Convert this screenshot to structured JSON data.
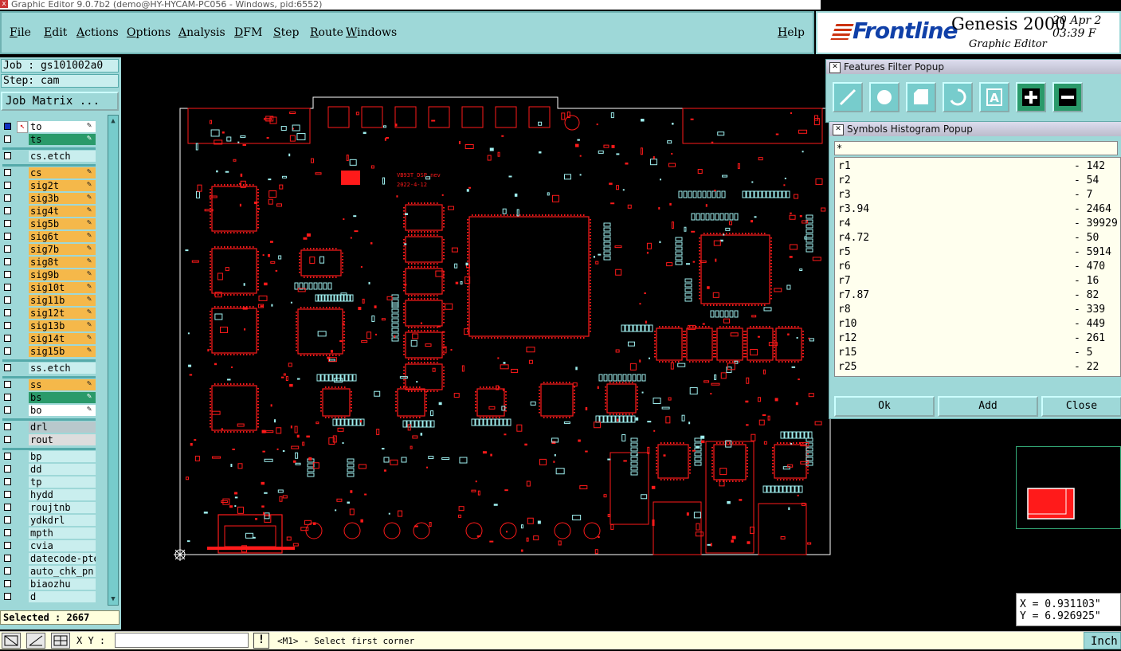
{
  "window": {
    "title": "Graphic Editor 9.0.7b2 (demo@HY-HYCAM-PC056 - Windows, pid:6552)"
  },
  "menu": {
    "items": [
      "File",
      "Edit",
      "Actions",
      "Options",
      "Analysis",
      "DFM",
      "Step",
      "Route",
      "Windows"
    ],
    "help": "Help"
  },
  "brand": {
    "logo": "Frontline",
    "product": "Genesis 2000",
    "subtitle": "Graphic Editor",
    "date": "20 Apr 2",
    "time": "03:39 F"
  },
  "job": {
    "job_label": "Job : gs101002a0",
    "step_label": "Step: cam",
    "matrix_button": "Job Matrix ..."
  },
  "layers": [
    {
      "name": "to",
      "color": "#ffffff",
      "group": 1
    },
    {
      "name": "ts",
      "color": "#2a9a6a",
      "group": 1
    },
    {
      "name": "cs.etch",
      "color": "#c9eeee",
      "group": 2
    },
    {
      "name": "cs",
      "color": "#f5b84a",
      "group": 3
    },
    {
      "name": "sig2t",
      "color": "#f5b84a",
      "group": 3
    },
    {
      "name": "sig3b",
      "color": "#f5b84a",
      "group": 3
    },
    {
      "name": "sig4t",
      "color": "#f5b84a",
      "group": 3
    },
    {
      "name": "sig5b",
      "color": "#f5b84a",
      "group": 3
    },
    {
      "name": "sig6t",
      "color": "#f5b84a",
      "group": 3
    },
    {
      "name": "sig7b",
      "color": "#f5b84a",
      "group": 3
    },
    {
      "name": "sig8t",
      "color": "#f5b84a",
      "group": 3
    },
    {
      "name": "sig9b",
      "color": "#f5b84a",
      "group": 3
    },
    {
      "name": "sig10t",
      "color": "#f5b84a",
      "group": 3
    },
    {
      "name": "sig11b",
      "color": "#f5b84a",
      "group": 3
    },
    {
      "name": "sig12t",
      "color": "#f5b84a",
      "group": 3
    },
    {
      "name": "sig13b",
      "color": "#f5b84a",
      "group": 3
    },
    {
      "name": "sig14t",
      "color": "#f5b84a",
      "group": 3
    },
    {
      "name": "sig15b",
      "color": "#f5b84a",
      "group": 3
    },
    {
      "name": "ss.etch",
      "color": "#c9eeee",
      "group": 4
    },
    {
      "name": "ss",
      "color": "#f5b84a",
      "group": 5
    },
    {
      "name": "bs",
      "color": "#2a9a6a",
      "group": 5
    },
    {
      "name": "bo",
      "color": "#ffffff",
      "group": 5
    },
    {
      "name": "drl",
      "color": "#b8c8cc",
      "group": 6
    },
    {
      "name": "rout",
      "color": "#dddddd",
      "group": 6
    },
    {
      "name": "bp",
      "color": "#c9eeee",
      "group": 7
    },
    {
      "name": "dd",
      "color": "#c9eeee",
      "group": 7
    },
    {
      "name": "tp",
      "color": "#c9eeee",
      "group": 7
    },
    {
      "name": "hydd",
      "color": "#c9eeee",
      "group": 7
    },
    {
      "name": "roujtnb",
      "color": "#c9eeee",
      "group": 7
    },
    {
      "name": "ydkdrl",
      "color": "#c9eeee",
      "group": 7
    },
    {
      "name": "mpth",
      "color": "#c9eeee",
      "group": 7
    },
    {
      "name": "cvia",
      "color": "#c9eeee",
      "group": 7
    },
    {
      "name": "datecode-pte",
      "color": "#c9eeee",
      "group": 7
    },
    {
      "name": "auto_chk_pn.",
      "color": "#c9eeee",
      "group": 7
    },
    {
      "name": "biaozhu",
      "color": "#c9eeee",
      "group": 7
    },
    {
      "name": "d",
      "color": "#c9eeee",
      "group": 7
    }
  ],
  "selected": "Selected : 2667",
  "features_filter": {
    "title": "Features Filter Popup",
    "tools": [
      "line-icon",
      "pad-icon",
      "surface-icon",
      "arc-icon",
      "text-icon",
      "positive-icon",
      "negative-icon"
    ]
  },
  "histogram": {
    "title": "Symbols Histogram Popup",
    "filter": "*",
    "rows": [
      {
        "symbol": "r1",
        "count": "- 142"
      },
      {
        "symbol": "r2",
        "count": "- 54"
      },
      {
        "symbol": "r3",
        "count": "- 7"
      },
      {
        "symbol": "r3.94",
        "count": "- 2464"
      },
      {
        "symbol": "r4",
        "count": "- 39929"
      },
      {
        "symbol": "r4.72",
        "count": "- 50"
      },
      {
        "symbol": "r5",
        "count": "- 5914"
      },
      {
        "symbol": "r6",
        "count": "- 470"
      },
      {
        "symbol": "r7",
        "count": "- 16"
      },
      {
        "symbol": "r7.87",
        "count": "- 82"
      },
      {
        "symbol": "r8",
        "count": "- 339"
      },
      {
        "symbol": "r10",
        "count": "- 449"
      },
      {
        "symbol": "r12",
        "count": "- 261"
      },
      {
        "symbol": "r15",
        "count": "- 5"
      },
      {
        "symbol": "r25",
        "count": "- 22"
      }
    ],
    "buttons": {
      "ok": "Ok",
      "add": "Add",
      "close": "Close"
    }
  },
  "board": {
    "silk1": "VB93T_DSP_nev",
    "silk2": "2022-4-12"
  },
  "coords": {
    "x": "X = 0.931103\"",
    "y": "Y = 6.926925\""
  },
  "status": {
    "xy_label": "X Y :",
    "xy_value": "",
    "prompt": "<M1> - Select first corner",
    "units": "Inch"
  },
  "colors": {
    "panel": "#9ed8d8",
    "feature_red": "#ff1a1a",
    "pad_cyan": "#9ff0f0"
  }
}
